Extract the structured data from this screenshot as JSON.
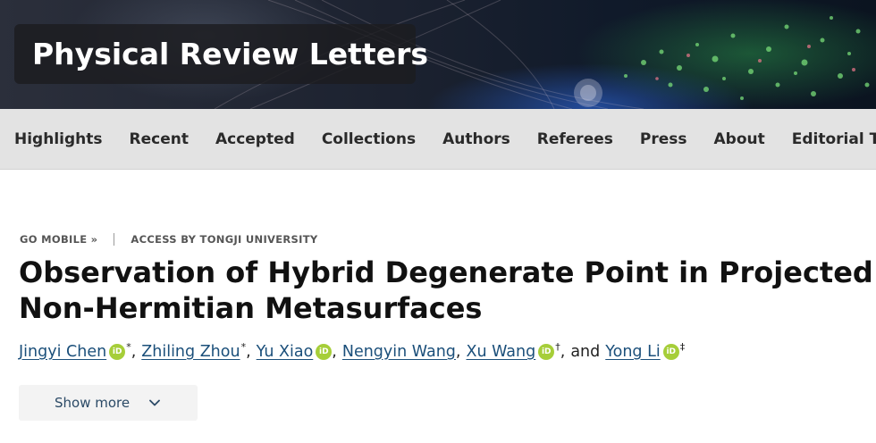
{
  "header": {
    "journal_title": "Physical Review Letters"
  },
  "nav": {
    "items": [
      {
        "label": "Highlights"
      },
      {
        "label": "Recent"
      },
      {
        "label": "Accepted"
      },
      {
        "label": "Collections"
      },
      {
        "label": "Authors"
      },
      {
        "label": "Referees"
      },
      {
        "label": "Press"
      },
      {
        "label": "About"
      },
      {
        "label": "Editorial Team"
      }
    ]
  },
  "meta": {
    "go_mobile": "GO MOBILE »",
    "access": "ACCESS BY TONGJI UNIVERSITY"
  },
  "article": {
    "title_line1": "Observation of Hybrid Degenerate Point in Projected",
    "title_line2": "Non-Hermitian Metasurfaces",
    "authors": [
      {
        "name": "Jingyi Chen",
        "orcid": true,
        "mark": "*"
      },
      {
        "name": "Zhiling Zhou",
        "orcid": false,
        "mark": "*"
      },
      {
        "name": "Yu Xiao",
        "orcid": true,
        "mark": ""
      },
      {
        "name": "Nengyin Wang",
        "orcid": false,
        "mark": ""
      },
      {
        "name": "Xu Wang",
        "orcid": true,
        "mark": "†"
      },
      {
        "name": "Yong Li",
        "orcid": true,
        "mark": "‡"
      }
    ],
    "separator": ",",
    "conjunction": "and",
    "orcid_label": "iD",
    "show_more": "Show more"
  },
  "icons": {
    "orcid": "orcid-icon",
    "chevron": "chevron-down-icon"
  },
  "colors": {
    "link": "#1b4f7a",
    "orcid": "#a6ce39",
    "nav_bg": "#e3e3e3"
  }
}
